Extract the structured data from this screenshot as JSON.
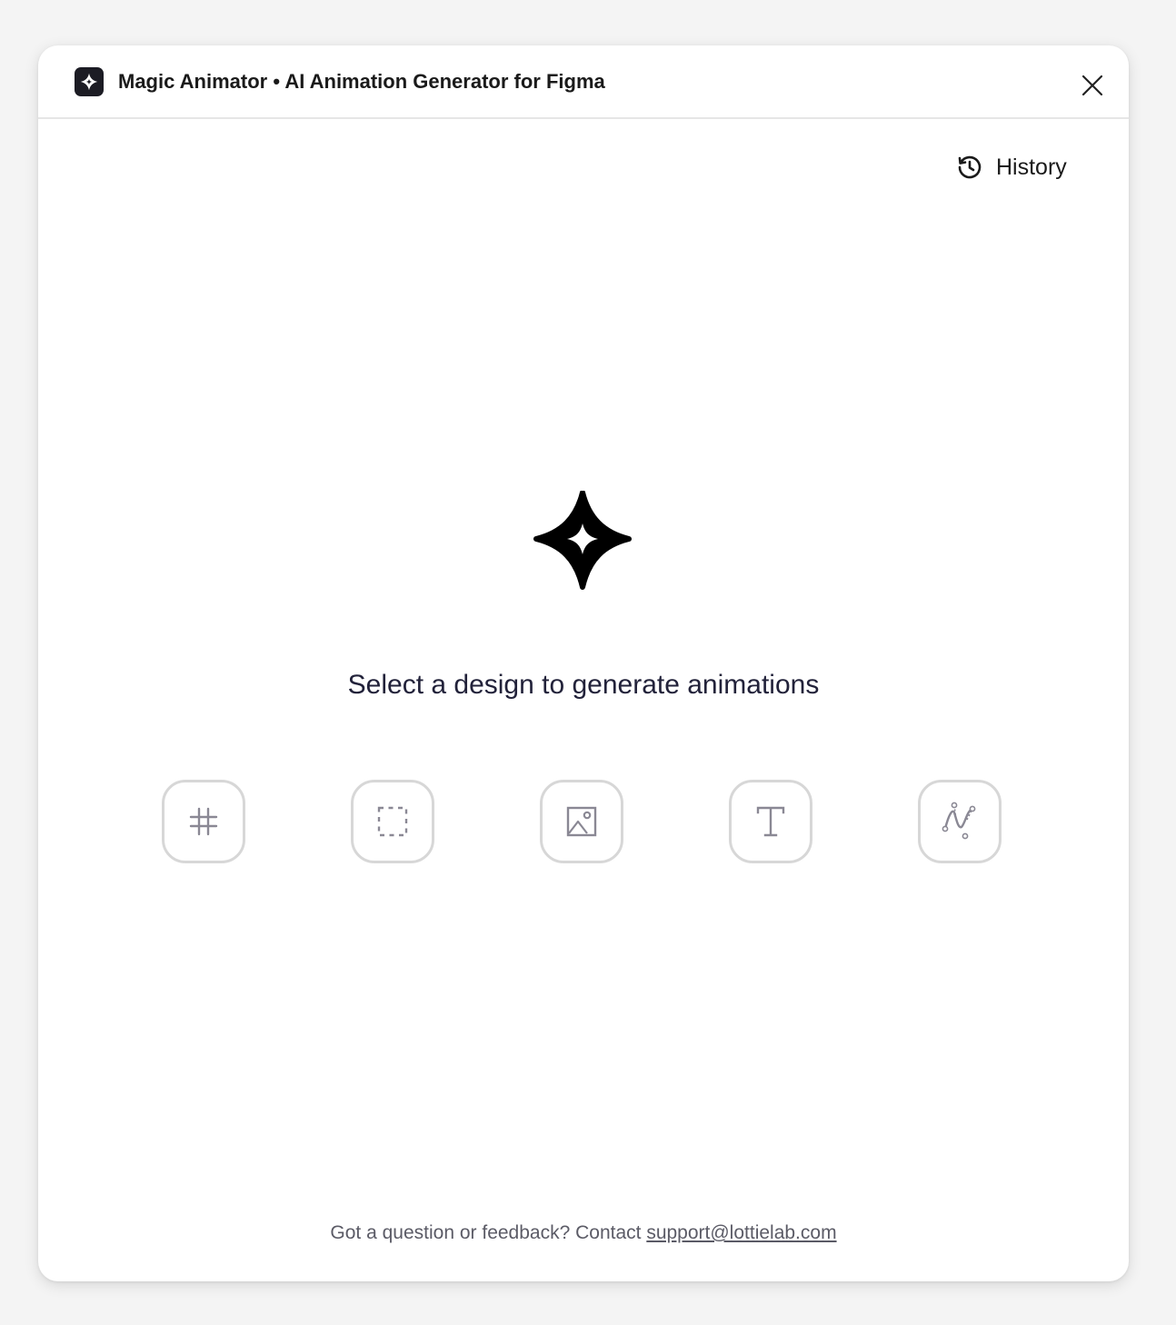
{
  "window": {
    "title": "Magic Animator • AI Animation Generator for Figma"
  },
  "toolbar": {
    "history_label": "History"
  },
  "main": {
    "prompt": "Select a design to generate animations",
    "layer_types": [
      {
        "name": "frame",
        "icon": "hash-icon"
      },
      {
        "name": "group",
        "icon": "dashed-square-icon"
      },
      {
        "name": "image",
        "icon": "image-icon"
      },
      {
        "name": "text",
        "icon": "text-icon"
      },
      {
        "name": "vector",
        "icon": "pen-path-icon"
      }
    ]
  },
  "footer": {
    "text": "Got a question or feedback? Contact ",
    "email": "support@lottielab.com"
  },
  "colors": {
    "brand": "#1c1c24",
    "icon_gray": "#8a8894",
    "tile_border": "#d7d7d7"
  }
}
